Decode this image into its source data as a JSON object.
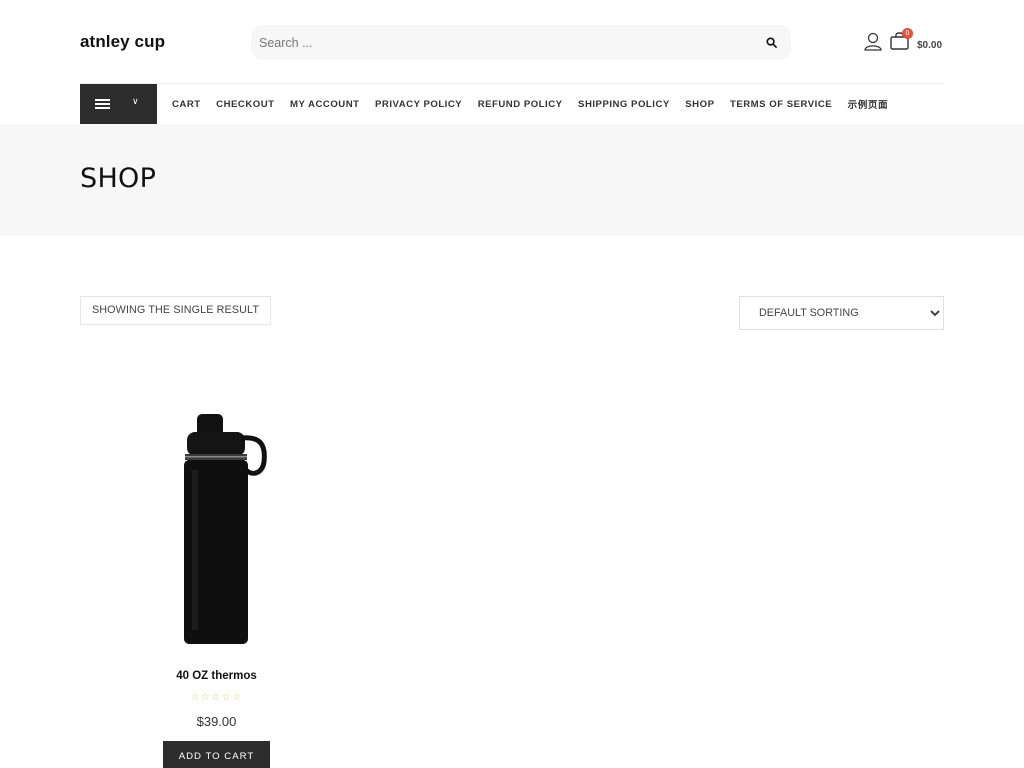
{
  "header": {
    "site_title": "atnley cup",
    "search": {
      "placeholder": "Search ...",
      "value": ""
    },
    "cart": {
      "count": "0",
      "total": "$0.00"
    },
    "icons": {
      "search": "search-icon",
      "account": "user-icon",
      "cart": "shopping-bag-icon"
    }
  },
  "nav": {
    "toggle_icons": [
      "hamburger-icon",
      "chevron-down-icon"
    ],
    "items": [
      {
        "label": "CART"
      },
      {
        "label": "CHECKOUT"
      },
      {
        "label": "MY ACCOUNT"
      },
      {
        "label": "PRIVACY POLICY"
      },
      {
        "label": "REFUND POLICY"
      },
      {
        "label": "SHIPPING POLICY"
      },
      {
        "label": "SHOP"
      },
      {
        "label": "TERMS OF SERVICE"
      },
      {
        "label": "示例页面"
      }
    ]
  },
  "page": {
    "title": "SHOP",
    "result_count": "SHOWING THE SINGLE RESULT",
    "sorting": {
      "selected": "DEFAULT SORTING",
      "options": [
        "DEFAULT SORTING"
      ]
    }
  },
  "products": [
    {
      "name": "40 OZ thermos",
      "rating_stars": "☆☆☆☆☆",
      "rating_value": 0,
      "rating_max": 5,
      "price": "$39.00",
      "add_to_cart_label": "ADD TO CART",
      "image": "black-insulated-water-bottle"
    }
  ],
  "colors": {
    "dark": "#2d2d2d",
    "band": "#f7f7f7",
    "badge": "#e0533b",
    "star": "#d9d36a"
  }
}
